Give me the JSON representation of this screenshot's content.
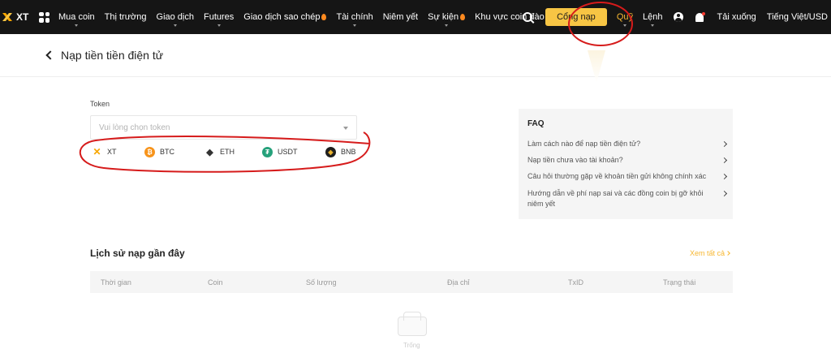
{
  "brand": {
    "logo_text": "XT"
  },
  "nav": {
    "items": [
      {
        "label": "Mua coin",
        "caret": true,
        "fire": false
      },
      {
        "label": "Thị trường",
        "caret": false,
        "fire": false
      },
      {
        "label": "Giao dịch",
        "caret": true,
        "fire": false
      },
      {
        "label": "Futures",
        "caret": true,
        "fire": false
      },
      {
        "label": "Giao dịch sao chép",
        "caret": false,
        "fire": true
      },
      {
        "label": "Tài chính",
        "caret": true,
        "fire": false
      },
      {
        "label": "Niêm yết",
        "caret": false,
        "fire": false
      },
      {
        "label": "Sự kiện",
        "caret": true,
        "fire": true
      },
      {
        "label": "Khu vực coin đào",
        "caret": false,
        "fire": true
      }
    ],
    "deposit_button": "Cổng nạp",
    "fund": "Quỹ",
    "orders": "Lệnh",
    "download": "Tải xuống",
    "language": "Tiếng Việt/USD"
  },
  "page": {
    "title": "Nạp tiền tiền điện tử"
  },
  "token": {
    "label": "Token",
    "placeholder": "Vui lòng chọn token",
    "quick_coins": [
      {
        "symbol": "XT",
        "icon": "xt-icon"
      },
      {
        "symbol": "BTC",
        "icon": "btc-icon"
      },
      {
        "symbol": "ETH",
        "icon": "eth-icon"
      },
      {
        "symbol": "USDT",
        "icon": "usdt-icon"
      },
      {
        "symbol": "BNB",
        "icon": "bnb-icon"
      }
    ]
  },
  "faq": {
    "title": "FAQ",
    "items": [
      "Làm cách nào để nạp tiền điện tử?",
      "Nạp tiền chưa vào tài khoản?",
      "Câu hỏi thường gặp về khoản tiền gửi không chính xác",
      "Hướng dẫn về phí nạp sai và các đồng coin bị gỡ khỏi niêm yết"
    ]
  },
  "history": {
    "title": "Lịch sử nạp gần đây",
    "view_all": "Xem tất cả",
    "columns": [
      "Thời gian",
      "Coin",
      "Số lượng",
      "Địa chỉ",
      "TxID",
      "Trạng thái"
    ],
    "empty_text": "Trống"
  },
  "colors": {
    "topbar": "#151515",
    "accent": "#f7c544",
    "link_accent": "#f7b731",
    "annotation": "#d61b1b"
  }
}
